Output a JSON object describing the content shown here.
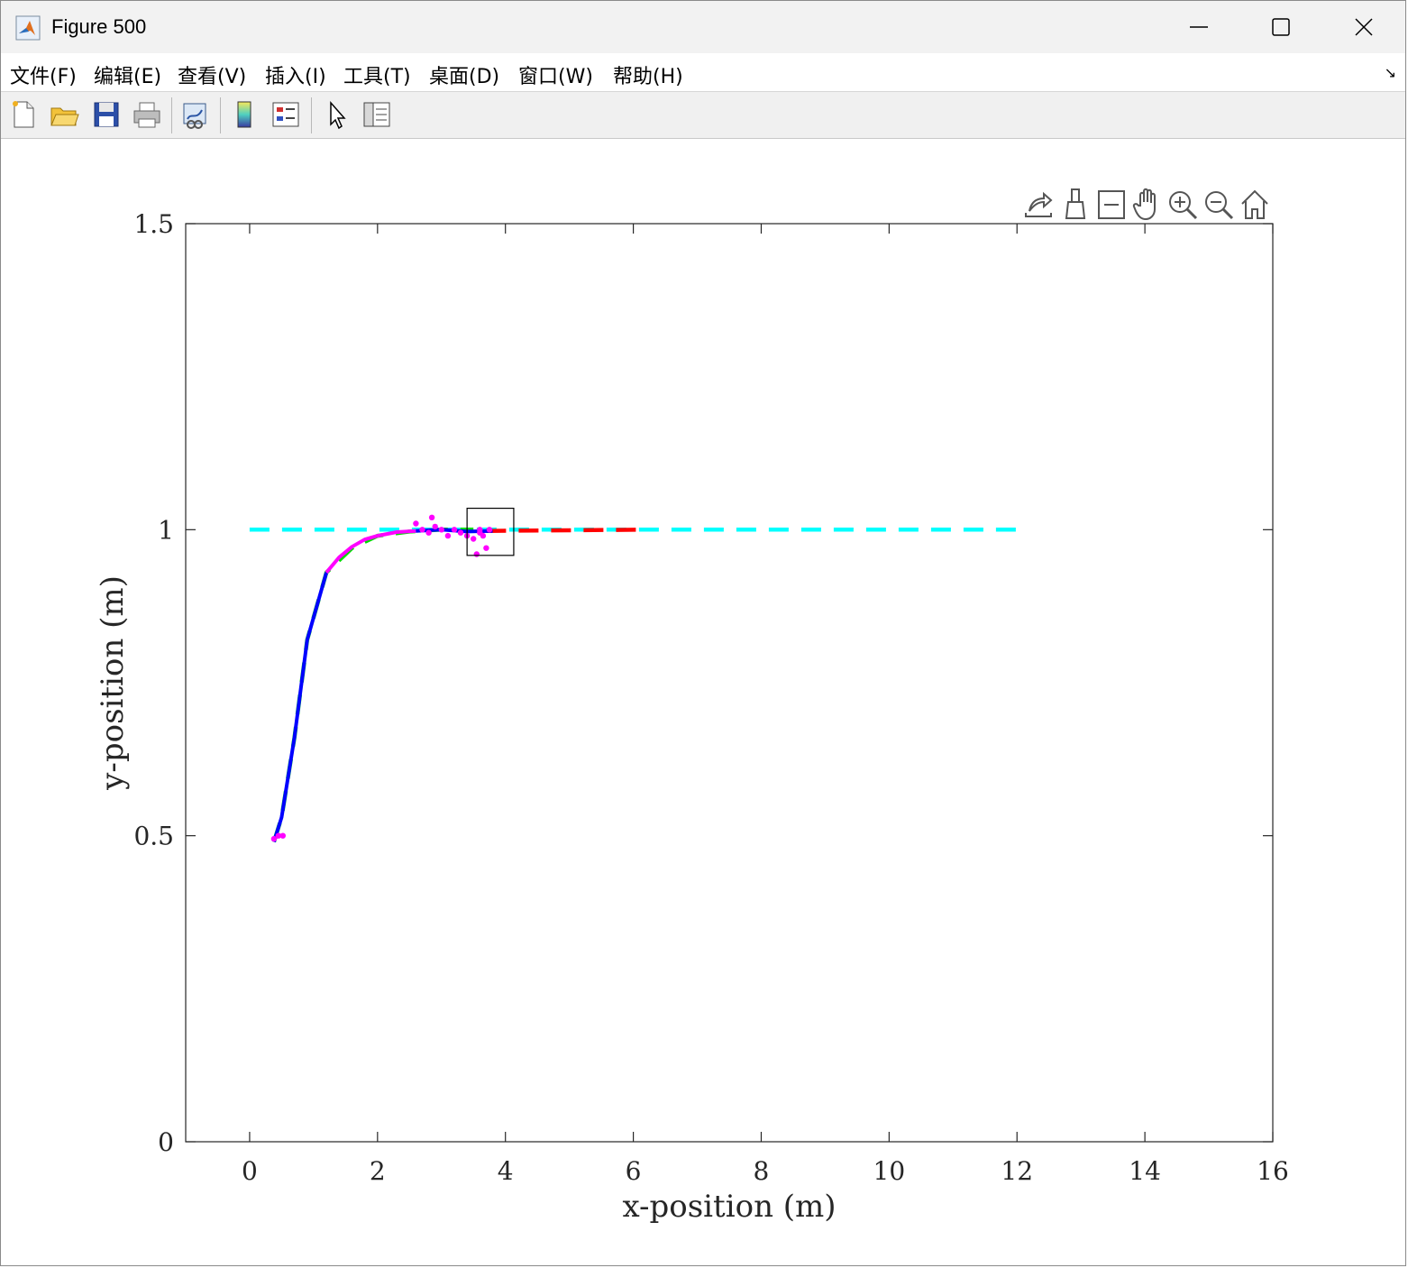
{
  "window": {
    "title": "Figure 500",
    "controls": [
      "minimize",
      "maximize",
      "close"
    ]
  },
  "menu": {
    "items": [
      "文件(F)",
      "编辑(E)",
      "查看(V)",
      "插入(I)",
      "工具(T)",
      "桌面(D)",
      "窗口(W)",
      "帮助(H)"
    ]
  },
  "toolbar": {
    "buttons": [
      "new-figure-icon",
      "open-file-icon",
      "save-icon",
      "print-icon",
      "link-plot-icon",
      "insert-colorbar-icon",
      "insert-legend-icon",
      "edit-plot-icon",
      "property-inspector-icon"
    ]
  },
  "axes_toolbar": {
    "buttons": [
      "export-icon",
      "brush-icon",
      "data-tips-icon",
      "pan-hand-icon",
      "zoom-in-icon",
      "zoom-out-icon",
      "home-icon"
    ]
  },
  "chart_data": {
    "type": "line",
    "xlabel": "x-position (m)",
    "ylabel": "y-position (m)",
    "xlim": [
      -1,
      16
    ],
    "ylim": [
      0,
      1.5
    ],
    "xticks": [
      "0",
      "2",
      "4",
      "6",
      "8",
      "10",
      "12",
      "14",
      "16"
    ],
    "yticks": [
      "0",
      "0.5",
      "1",
      "1.5"
    ],
    "grid": false,
    "series": [
      {
        "color": "#00ffff",
        "style": "dashed",
        "x": [
          0,
          12
        ],
        "y": [
          1,
          1
        ]
      },
      {
        "color": "#ff0000",
        "style": "dashed",
        "x": [
          3.7,
          6.2
        ],
        "y": [
          0.998,
          1
        ]
      },
      {
        "color": "#00dd00",
        "style": "dashed",
        "x": [
          0.38,
          0.5,
          0.7,
          0.9,
          1.2,
          1.6,
          2.0,
          2.5,
          3.0,
          3.5
        ],
        "y": [
          0.49,
          0.53,
          0.66,
          0.82,
          0.93,
          0.97,
          0.99,
          0.997,
          1.0,
          1.0
        ]
      },
      {
        "color": "#0000ff",
        "style": "solid",
        "x": [
          0.38,
          0.5,
          0.7,
          0.9,
          1.2
        ],
        "y": [
          0.49,
          0.53,
          0.66,
          0.82,
          0.93
        ]
      },
      {
        "color": "#ff00ff",
        "style": "solid",
        "x": [
          1.2,
          1.4,
          1.6,
          1.8,
          2.0,
          2.3,
          2.6
        ],
        "y": [
          0.93,
          0.955,
          0.972,
          0.984,
          0.99,
          0.996,
          0.998
        ]
      },
      {
        "color": "#0000ff",
        "style": "solid",
        "x": [
          2.6,
          3.0,
          3.4,
          3.8
        ],
        "y": [
          0.998,
          1.0,
          0.997,
          0.998
        ]
      }
    ],
    "scatter": {
      "color": "#ff00ff",
      "x": [
        0.38,
        0.45,
        0.52,
        2.6,
        2.7,
        2.8,
        2.85,
        2.9,
        3.0,
        3.1,
        3.2,
        3.3,
        3.4,
        3.5,
        3.55,
        3.6,
        3.65,
        3.7,
        3.75,
        3.6
      ],
      "y": [
        0.495,
        0.5,
        0.5,
        1.01,
        1.0,
        0.995,
        1.02,
        1.005,
        1.0,
        0.99,
        1.0,
        0.995,
        0.99,
        0.985,
        0.96,
        1.0,
        0.99,
        0.97,
        1.0,
        0.995
      ]
    },
    "annotation_box": {
      "x": [
        3.4,
        4.13
      ],
      "y": [
        0.958,
        1.035
      ]
    }
  }
}
